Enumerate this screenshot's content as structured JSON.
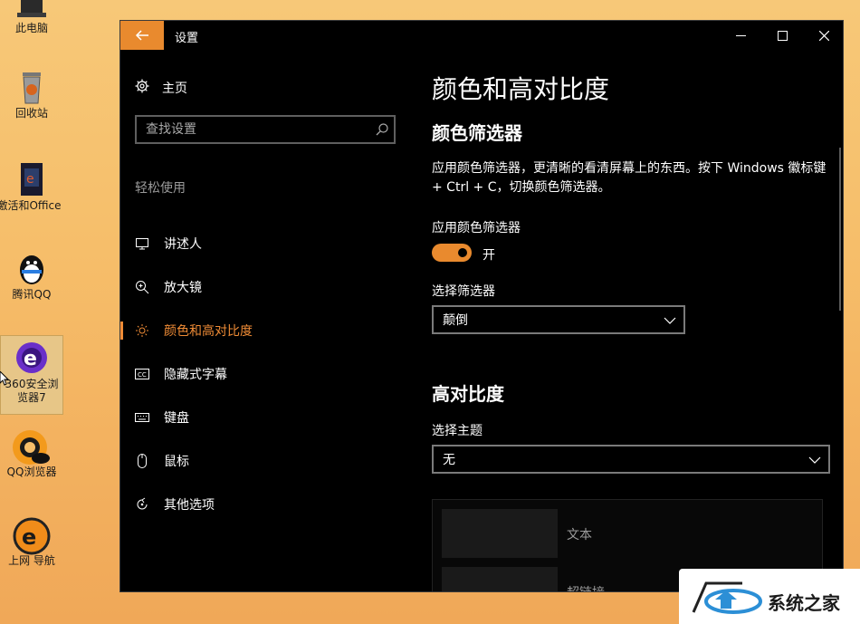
{
  "desktop": {
    "icons": [
      {
        "label": "此电脑"
      },
      {
        "label": "回收站"
      },
      {
        "label": "激活和Office"
      },
      {
        "label": "腾讯QQ"
      },
      {
        "label": "360安全浏览器7"
      },
      {
        "label": "QQ浏览器"
      },
      {
        "label": "上网 导航"
      }
    ]
  },
  "window": {
    "title": "设置",
    "controls": [
      "minimize-icon",
      "maximize-icon",
      "close-icon"
    ],
    "accent_color": "#e98a2e"
  },
  "nav": {
    "home_label": "主页",
    "search_placeholder": "查找设置",
    "section_label": "轻松使用",
    "items": [
      {
        "label": "讲述人",
        "icon": "narrator-icon"
      },
      {
        "label": "放大镜",
        "icon": "magnifier-icon"
      },
      {
        "label": "颜色和高对比度",
        "icon": "brightness-icon",
        "active": true
      },
      {
        "label": "隐藏式字幕",
        "icon": "caption-icon"
      },
      {
        "label": "键盘",
        "icon": "keyboard-icon"
      },
      {
        "label": "鼠标",
        "icon": "mouse-icon"
      },
      {
        "label": "其他选项",
        "icon": "other-options-icon"
      }
    ]
  },
  "main": {
    "page_title": "颜色和高对比度",
    "color_filter": {
      "heading": "颜色筛选器",
      "description": "应用颜色筛选器，更清晰的看清屏幕上的东西。按下 Windows 徽标键 + Ctrl + C，切换颜色筛选器。",
      "toggle_label": "应用颜色筛选器",
      "toggle_state": "开",
      "toggle_on": true,
      "select_label": "选择筛选器",
      "select_value": "颠倒"
    },
    "high_contrast": {
      "heading": "高对比度",
      "theme_label": "选择主题",
      "theme_value": "无",
      "preview_items": [
        "文本",
        "超链接"
      ]
    }
  },
  "watermark": {
    "text": "系统之家"
  }
}
